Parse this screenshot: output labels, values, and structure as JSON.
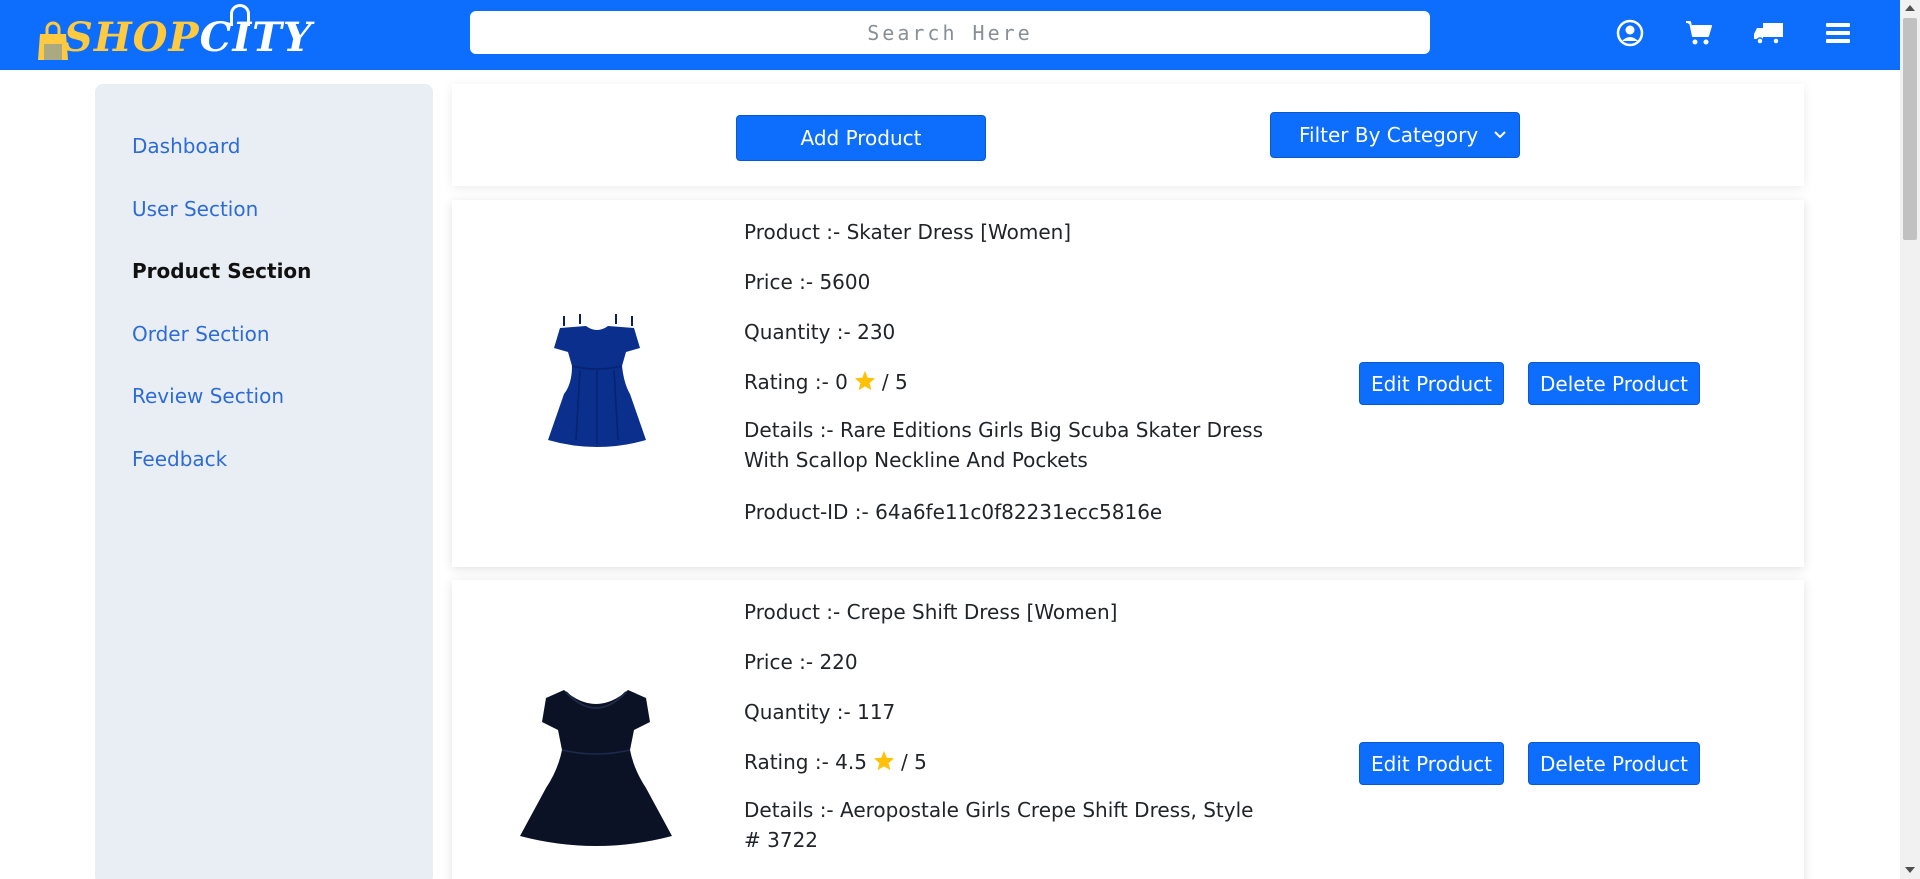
{
  "header": {
    "logo_text": "SHOPCITY",
    "search_placeholder": "Search Here",
    "icons": [
      "user-circle-icon",
      "cart-icon",
      "truck-icon",
      "hamburger-menu-icon"
    ],
    "brand_color": "#0d6efd",
    "logo_color": "#ffc940"
  },
  "sidebar": {
    "items": [
      {
        "label": "Dashboard",
        "active": false
      },
      {
        "label": "User Section",
        "active": false
      },
      {
        "label": "Product Section",
        "active": true
      },
      {
        "label": "Order Section",
        "active": false
      },
      {
        "label": "Review Section",
        "active": false
      },
      {
        "label": "Feedback",
        "active": false
      }
    ]
  },
  "toolbar": {
    "add_label": "Add Product",
    "filter_label": "Filter By Category"
  },
  "products": [
    {
      "name_line": "Product :- Skater Dress [Women]",
      "price_line": "Price :- 5600",
      "quantity_line": "Quantity :- 230",
      "rating_prefix": "Rating :- 0",
      "rating_suffix": "/ 5",
      "details_line": "Details :- Rare Editions Girls Big Scuba Skater Dress With Scallop Neckline And Pockets",
      "id_line": "Product-ID :- 64a6fe11c0f82231ecc5816e",
      "image": "blue-skater-dress",
      "edit_label": "Edit Product",
      "delete_label": "Delete Product"
    },
    {
      "name_line": "Product :- Crepe Shift Dress [Women]",
      "price_line": "Price :- 220",
      "quantity_line": "Quantity :- 117",
      "rating_prefix": "Rating :- 4.5",
      "rating_suffix": "/ 5",
      "details_line": "Details :- Aeropostale Girls Crepe Shift Dress, Style # 3722",
      "image": "black-shift-dress",
      "edit_label": "Edit Product",
      "delete_label": "Delete Product"
    }
  ],
  "colors": {
    "primary": "#0d6efd",
    "sidebar_bg": "#e9eef4",
    "link": "#2d6cd6",
    "star": "#ffc107"
  }
}
